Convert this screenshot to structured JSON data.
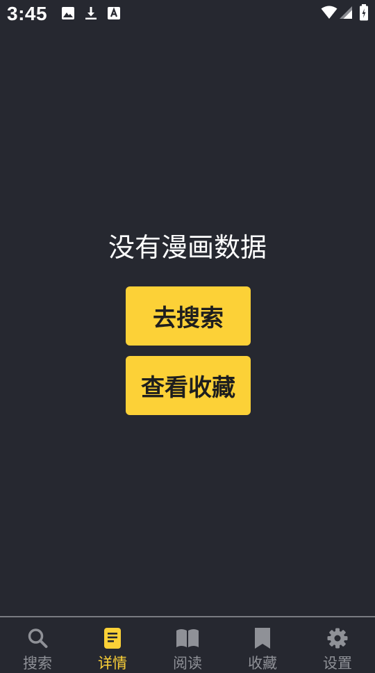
{
  "status_bar": {
    "time": "3:45",
    "icons": [
      "image-icon",
      "download-icon",
      "text-a-icon",
      "wifi-icon",
      "signal-icon",
      "battery-charging-icon"
    ]
  },
  "main": {
    "empty_message": "没有漫画数据",
    "search_button_label": "去搜索",
    "favorites_button_label": "查看收藏"
  },
  "bottom_nav": {
    "active_index": 1,
    "items": [
      {
        "label": "搜索",
        "icon": "search-icon"
      },
      {
        "label": "详情",
        "icon": "document-icon"
      },
      {
        "label": "阅读",
        "icon": "book-open-icon"
      },
      {
        "label": "收藏",
        "icon": "bookmark-icon"
      },
      {
        "label": "设置",
        "icon": "gear-icon"
      }
    ]
  },
  "colors": {
    "background": "#262830",
    "accent": "#fcd137",
    "nav_inactive": "#8f9197",
    "text": "#ffffff"
  }
}
